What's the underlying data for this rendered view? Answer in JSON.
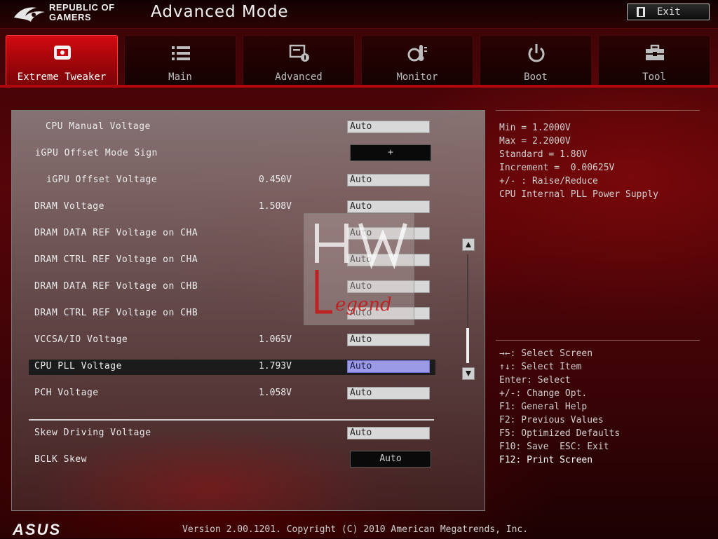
{
  "header": {
    "brand_line1": "REPUBLIC OF",
    "brand_line2": "GAMERS",
    "mode_title": "Advanced Mode",
    "exit_label": "Exit"
  },
  "tabs": [
    {
      "label": "Extreme Tweaker",
      "icon": "tweaker-icon",
      "active": true
    },
    {
      "label": "Main",
      "icon": "list-icon",
      "active": false
    },
    {
      "label": "Advanced",
      "icon": "advanced-settings-icon",
      "active": false
    },
    {
      "label": "Monitor",
      "icon": "thermometer-icon",
      "active": false
    },
    {
      "label": "Boot",
      "icon": "power-icon",
      "active": false
    },
    {
      "label": "Tool",
      "icon": "toolbox-icon",
      "active": false
    }
  ],
  "settings": [
    {
      "name": "CPU Manual Voltage",
      "value": "",
      "control": "Auto"
    },
    {
      "name": "iGPU Offset Mode Sign",
      "value": "",
      "control": "+"
    },
    {
      "name": "iGPU Offset Voltage",
      "value": "0.450V",
      "control": "Auto"
    },
    {
      "name": "DRAM Voltage",
      "value": "1.508V",
      "control": "Auto"
    },
    {
      "name": "DRAM DATA REF Voltage on CHA",
      "value": "",
      "control": "Auto"
    },
    {
      "name": "DRAM CTRL REF Voltage on CHA",
      "value": "",
      "control": "Auto"
    },
    {
      "name": "DRAM DATA REF Voltage on CHB",
      "value": "",
      "control": "Auto"
    },
    {
      "name": "DRAM CTRL REF Voltage on CHB",
      "value": "",
      "control": "Auto"
    },
    {
      "name": "VCCSA/IO Voltage",
      "value": "1.065V",
      "control": "Auto"
    },
    {
      "name": "CPU PLL Voltage",
      "value": "1.793V",
      "control": "Auto",
      "selected": true
    },
    {
      "name": "PCH Voltage",
      "value": "1.058V",
      "control": "Auto"
    },
    {
      "name": "Skew Driving Voltage",
      "value": "",
      "control": "Auto"
    },
    {
      "name": "BCLK Skew",
      "value": "",
      "control": "Auto"
    }
  ],
  "info": [
    "Min = 1.2000V",
    "Max = 2.2000V",
    "Standard = 1.80V",
    "Increment =  0.00625V",
    "+/- : Raise/Reduce",
    "CPU Internal PLL Power Supply"
  ],
  "keys": [
    "→←: Select Screen",
    "↑↓: Select Item",
    "Enter: Select",
    "+/-: Change Opt.",
    "F1: General Help",
    "F2: Previous Values",
    "F5: Optimized Defaults",
    "F10: Save  ESC: Exit",
    "F12: Print Screen"
  ],
  "watermark": "HW Legend",
  "footer": {
    "brand": "ASUS",
    "version": "Version 2.00.1201. Copyright (C) 2010 American Megatrends, Inc."
  },
  "colors": {
    "accent": "#c8080e",
    "selected_field": "#9a9ae6"
  }
}
